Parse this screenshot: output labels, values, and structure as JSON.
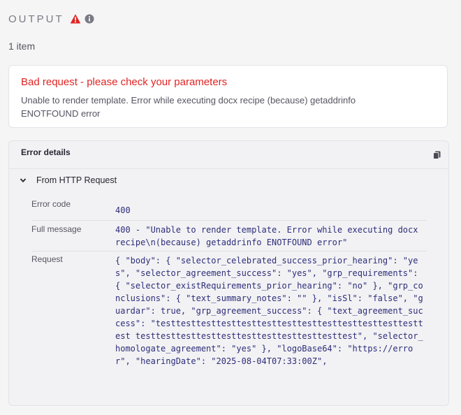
{
  "header": {
    "title": "OUTPUT",
    "warning_icon": "warning-triangle-icon",
    "info_icon": "info-circle-icon",
    "warning_color": "#e02424"
  },
  "count_text": "1 item",
  "error_card": {
    "title": "Bad request - please check your parameters",
    "message": "Unable to render template. Error while executing docx recipe (because) getaddrinfo ENOTFOUND error"
  },
  "details": {
    "title": "Error details",
    "copy_icon": "copy-icon",
    "section": {
      "label": "From HTTP Request",
      "chevron_icon": "chevron-down-icon",
      "rows": [
        {
          "label": "Error code",
          "value": "400"
        },
        {
          "label": "Full message",
          "value": "400 - \"Unable to render template. Error while executing docx recipe\\n(because) getaddrinfo ENOTFOUND error\""
        },
        {
          "label": "Request",
          "value": "{ \"body\": { \"selector_celebrated_success_prior_hearing\": \"yes\", \"selector_agreement_success\": \"yes\", \"grp_requirements\": { \"selector_existRequirements_prior_hearing\": \"no\" }, \"grp_conclusions\": { \"text_summary_notes\": \"\" }, \"isSl\": \"false\", \"guardar\": true, \"grp_agreement_success\": { \"text_agreement_success\": \"testtesttesttesttesttesttesttesttesttesttesttesttesttest testtesttesttesttesttesttesttesttesttesttest\", \"selector_homologate_agreement\": \"yes\" }, \"logoBase64\": \"https://error\", \"hearingDate\": \"2025-08-04T07:33:00Z\","
        }
      ]
    }
  }
}
